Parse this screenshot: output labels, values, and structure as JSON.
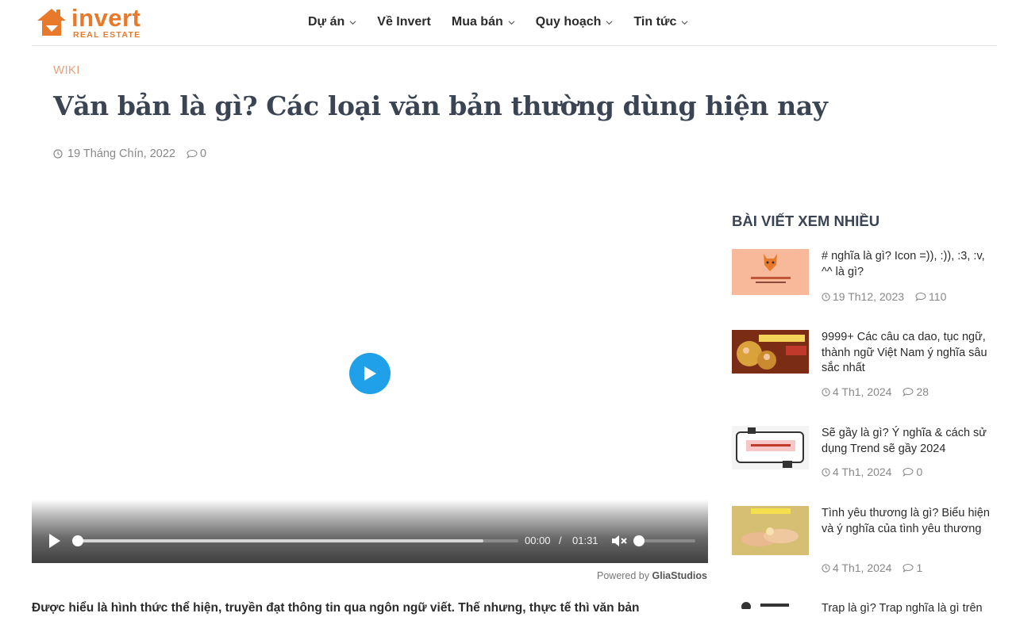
{
  "brand": {
    "name": "invert",
    "tagline": "REAL ESTATE",
    "color": "#e8792b"
  },
  "nav": {
    "items": [
      {
        "label": "Dự án",
        "dropdown": true
      },
      {
        "label": "Về Invert",
        "dropdown": false
      },
      {
        "label": "Mua bán",
        "dropdown": true
      },
      {
        "label": "Quy hoạch",
        "dropdown": true
      },
      {
        "label": "Tin tức",
        "dropdown": true
      }
    ]
  },
  "article": {
    "category": "WIKI",
    "title": "Văn bản là gì? Các loại văn bản thường dùng hiện nay",
    "date": "19 Tháng Chín, 2022",
    "comments": "0",
    "lead": "Được hiểu là hình thức thể hiện, truyền đạt thông tin qua ngôn ngữ viết. Thế nhưng, thực tế thì văn bản"
  },
  "video": {
    "current_time": "00:00",
    "separator": "/",
    "duration": "01:31",
    "progress_fraction": 0.0,
    "buffered_fraction": 0.92,
    "volume_fraction": 0.0,
    "muted": true,
    "play_button_color": "#1fa0e8",
    "powered_by_prefix": "Powered by",
    "powered_by_brand": "GliaStudios"
  },
  "sidebar": {
    "title": "BÀI VIẾT XEM NHIỀU",
    "posts": [
      {
        "title": "# nghĩa là gì? Icon =)), :)), :3, :v, ^^ là gì?",
        "date": "19 Th12, 2023",
        "comments": "110",
        "thumb_label": "XEM =)), :3, :v,... BIẾT NGAY TỪ ĐIỂN!"
      },
      {
        "title": "9999+ Các câu ca dao, tục ngữ, thành ngữ Việt Nam ý nghĩa sâu sắc nhất",
        "date": "4 Th1, 2024",
        "comments": "28",
        "thumb_label": "CA DAO & TỤC NGỮ VIỆT NAM"
      },
      {
        "title": "Sẽ gầy là gì? Ý nghĩa & cách sử dụng Trend sẽ gầy 2024",
        "date": "4 Th1, 2024",
        "comments": "0",
        "thumb_label": "SẼ GẦY LÀ GÌ?"
      },
      {
        "title": "Tình yêu thương là gì? Biểu hiện và ý nghĩa của tình yêu thương",
        "date": "4 Th1, 2024",
        "comments": "1",
        "thumb_label": "Tình yêu thương là gì"
      },
      {
        "title": "Trap là gì? Trap nghĩa là gì trên",
        "date": "",
        "comments": "",
        "thumb_label": "TRAP LÀ GÌ"
      }
    ]
  }
}
